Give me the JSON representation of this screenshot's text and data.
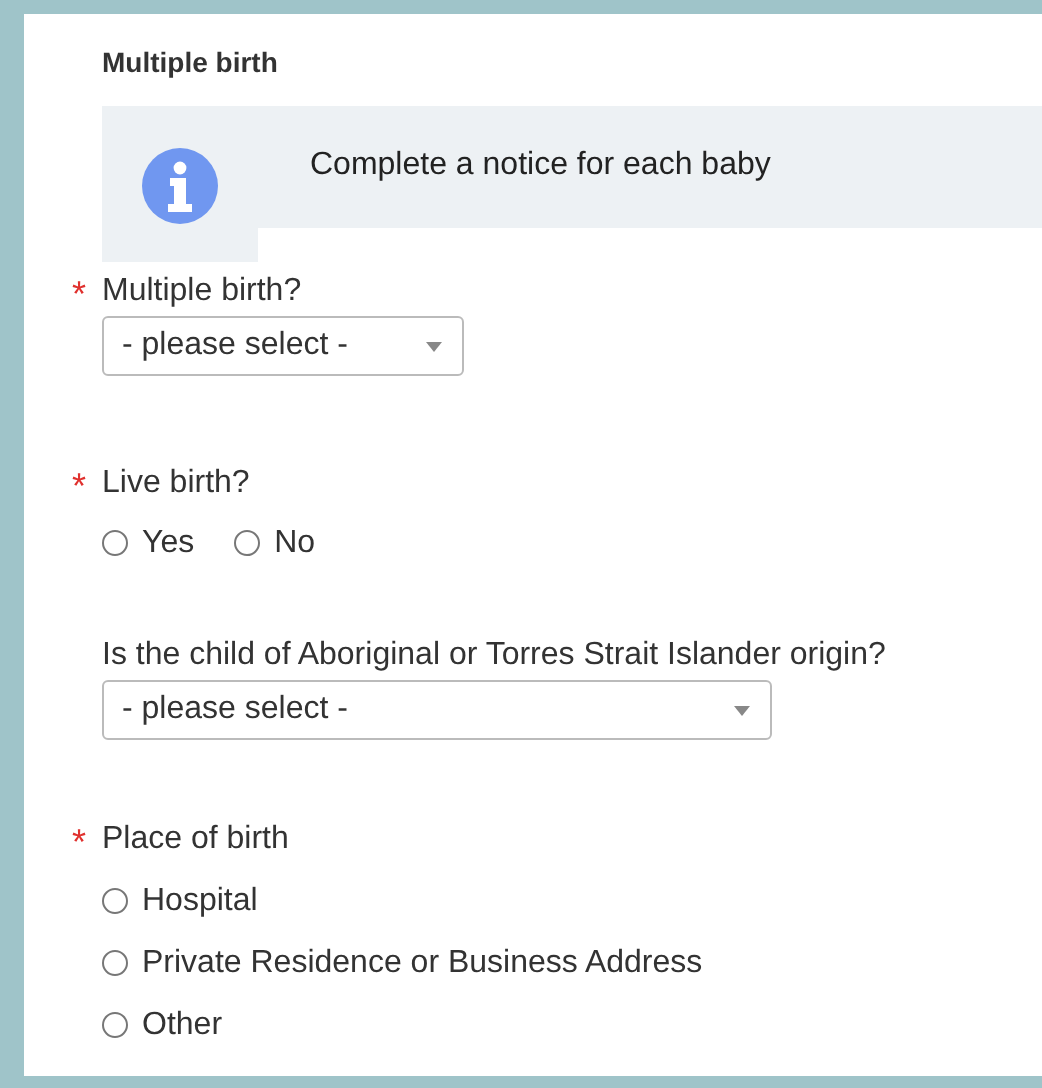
{
  "section_title": "Multiple birth",
  "notice": {
    "text": "Complete a notice for each baby"
  },
  "fields": [
    {
      "kind": "select_short",
      "label": "Multiple birth?",
      "required_mark": "*",
      "placeholder": "- please select -"
    },
    {
      "kind": "radio_inline",
      "label": "Live birth?",
      "required_mark": "*",
      "options": [
        {
          "label": "Yes",
          "selected": false
        },
        {
          "label": "No",
          "selected": false
        }
      ]
    },
    {
      "kind": "select_wide",
      "label": "Is the child of Aboriginal or Torres Strait Islander origin?",
      "placeholder": "- please select -"
    },
    {
      "kind": "radio_stacked",
      "label": "Place of birth",
      "required_mark": "*",
      "options": [
        {
          "label": "Hospital",
          "selected": false
        },
        {
          "label": "Private Residence or Business Address",
          "selected": false
        },
        {
          "label": "Other",
          "selected": false
        }
      ]
    }
  ]
}
